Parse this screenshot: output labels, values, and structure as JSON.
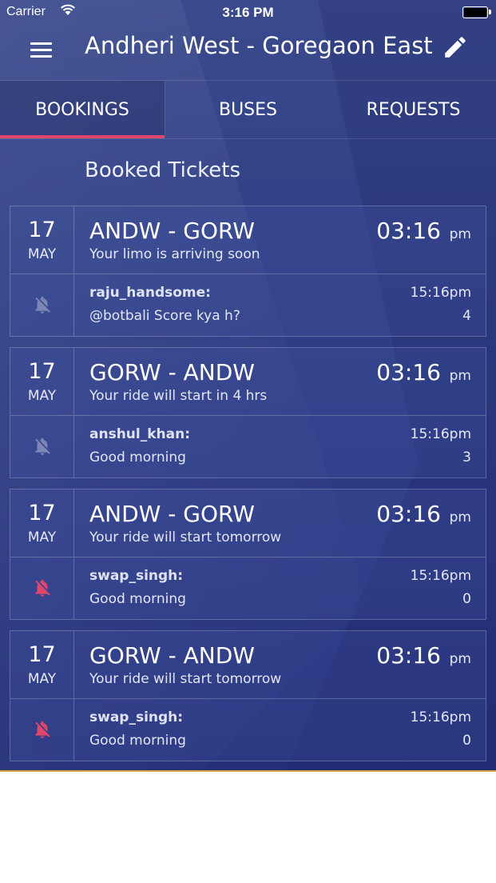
{
  "status_bar": {
    "carrier": "Carrier",
    "time": "3:16 PM"
  },
  "app_bar": {
    "title": "Andheri West - Goregaon East"
  },
  "tabs": [
    {
      "label": "BOOKINGS",
      "active": true
    },
    {
      "label": "BUSES",
      "active": false
    },
    {
      "label": "REQUESTS",
      "active": false
    }
  ],
  "section_title": "Booked Tickets",
  "colors": {
    "accent": "#e0466b",
    "bell_muted": "#7d86b5",
    "bottom_stripe": "#d9a640"
  },
  "bookings": [
    {
      "day": "17",
      "month": "MAY",
      "route": "ANDW - GORW",
      "time": "03:16",
      "ampm": "pm",
      "subtitle": "Your limo is arriving soon",
      "sender": "raju_handsome:",
      "message": "@botbali Score kya h?",
      "msg_time": "15:16pm",
      "count": "4",
      "bell": "bell-off-icon",
      "bell_active": false
    },
    {
      "day": "17",
      "month": "MAY",
      "route": "GORW - ANDW",
      "time": "03:16",
      "ampm": "pm",
      "subtitle": "Your ride will start in 4 hrs",
      "sender": "anshul_khan:",
      "message": "Good morning",
      "msg_time": "15:16pm",
      "count": "3",
      "bell": "bell-off-icon",
      "bell_active": false
    },
    {
      "day": "17",
      "month": "MAY",
      "route": "ANDW - GORW",
      "time": "03:16",
      "ampm": "pm",
      "subtitle": "Your ride will start tomorrow",
      "sender": "swap_singh:",
      "message": "Good morning",
      "msg_time": "15:16pm",
      "count": "0",
      "bell": "bell-off-icon",
      "bell_active": true
    },
    {
      "day": "17",
      "month": "MAY",
      "route": "GORW - ANDW",
      "time": "03:16",
      "ampm": "pm",
      "subtitle": "Your ride will start tomorrow",
      "sender": "swap_singh:",
      "message": "Good morning",
      "msg_time": "15:16pm",
      "count": "0",
      "bell": "bell-off-icon",
      "bell_active": true
    }
  ]
}
